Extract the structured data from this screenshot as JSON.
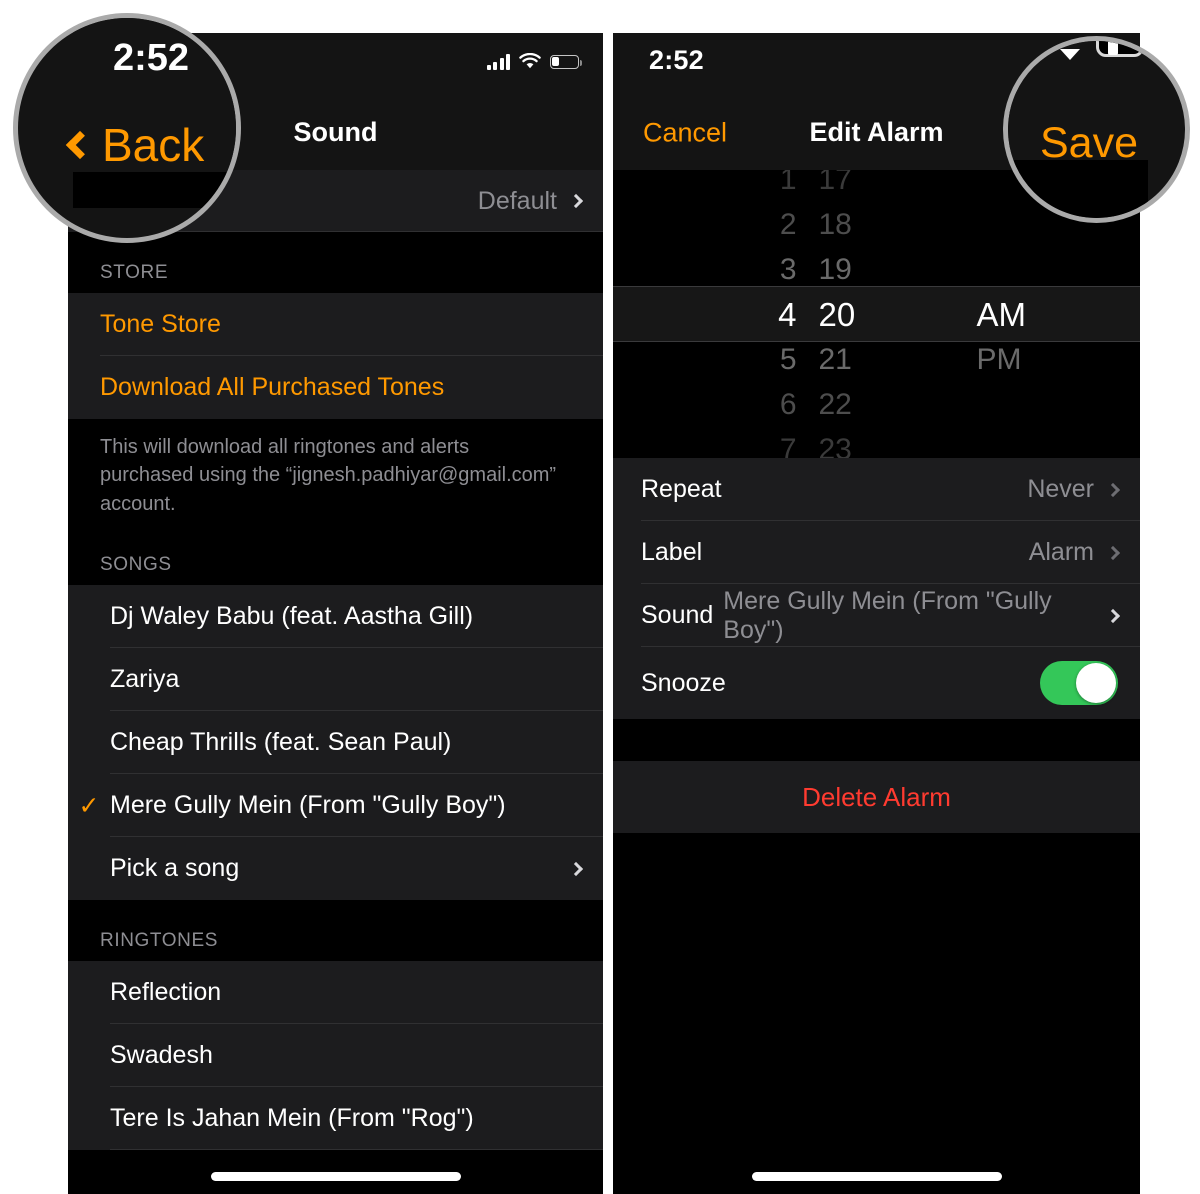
{
  "meta": {
    "accent_orange": "#ff9500",
    "destructive_red": "#ff3b30",
    "toggle_green": "#34c759",
    "muted_gray": "#8e8e93",
    "callout_ring": "#aaaaaa"
  },
  "left_phone": {
    "status_bar": {
      "time": "2:52",
      "cellular_icon": "cellular-bars-icon",
      "wifi_icon": "wifi-icon",
      "battery_icon": "battery-icon",
      "battery_level_percent": 28
    },
    "nav": {
      "back_label": "Back",
      "back_icon": "chevron-left-icon",
      "title": "Sound"
    },
    "vibration_row": {
      "value": "Default",
      "chevron_icon": "chevron-right-icon"
    },
    "store_section": {
      "header": "STORE",
      "items": [
        {
          "label": "Tone Store"
        },
        {
          "label": "Download All Purchased Tones"
        }
      ],
      "footnote": "This will download all ringtones and alerts purchased using the “jignesh.padhiyar@gmail.com” account."
    },
    "songs_section": {
      "header": "SONGS",
      "items": [
        {
          "label": "Dj Waley Babu (feat. Aastha Gill)",
          "selected": false,
          "chevron": false
        },
        {
          "label": "Zariya",
          "selected": false,
          "chevron": false
        },
        {
          "label": "Cheap Thrills (feat. Sean Paul)",
          "selected": false,
          "chevron": false
        },
        {
          "label": "Mere Gully Mein (From \"Gully Boy\")",
          "selected": true,
          "chevron": false
        },
        {
          "label": "Pick a song",
          "selected": false,
          "chevron": true
        }
      ],
      "checkmark_glyph": "✓",
      "checkmark_icon": "checkmark-icon"
    },
    "ringtones_section": {
      "header": "RINGTONES",
      "items": [
        {
          "label": "Reflection"
        },
        {
          "label": "Swadesh"
        },
        {
          "label": "Tere Is Jahan Mein (From \"Rog\")"
        }
      ]
    },
    "home_indicator": "home-indicator"
  },
  "right_phone": {
    "status_bar": {
      "time": "2:52",
      "wifi_icon": "wifi-icon",
      "battery_icon": "battery-icon"
    },
    "nav": {
      "cancel_label": "Cancel",
      "title": "Edit Alarm",
      "save_label": "Save"
    },
    "time_picker": {
      "hours": [
        "1",
        "2",
        "3",
        "4",
        "5",
        "6",
        "7"
      ],
      "minutes": [
        "17",
        "18",
        "19",
        "20",
        "21",
        "22",
        "23"
      ],
      "periods": [
        "AM",
        "PM"
      ],
      "selected_hour": "4",
      "selected_minute": "20",
      "selected_period": "AM"
    },
    "settings_rows": [
      {
        "label": "Repeat",
        "value": "Never",
        "type": "disclosure"
      },
      {
        "label": "Label",
        "value": "Alarm",
        "type": "disclosure"
      },
      {
        "label": "Sound",
        "value": "Mere Gully Mein (From \"Gully Boy\")",
        "type": "disclosure"
      },
      {
        "label": "Snooze",
        "value": "",
        "type": "toggle",
        "toggle_on": true
      }
    ],
    "delete_label": "Delete Alarm",
    "home_indicator": "home-indicator"
  },
  "callouts": {
    "back": {
      "time": "2:52",
      "label": "Back",
      "icon": "chevron-left-icon"
    },
    "save": {
      "label": "Save"
    }
  }
}
